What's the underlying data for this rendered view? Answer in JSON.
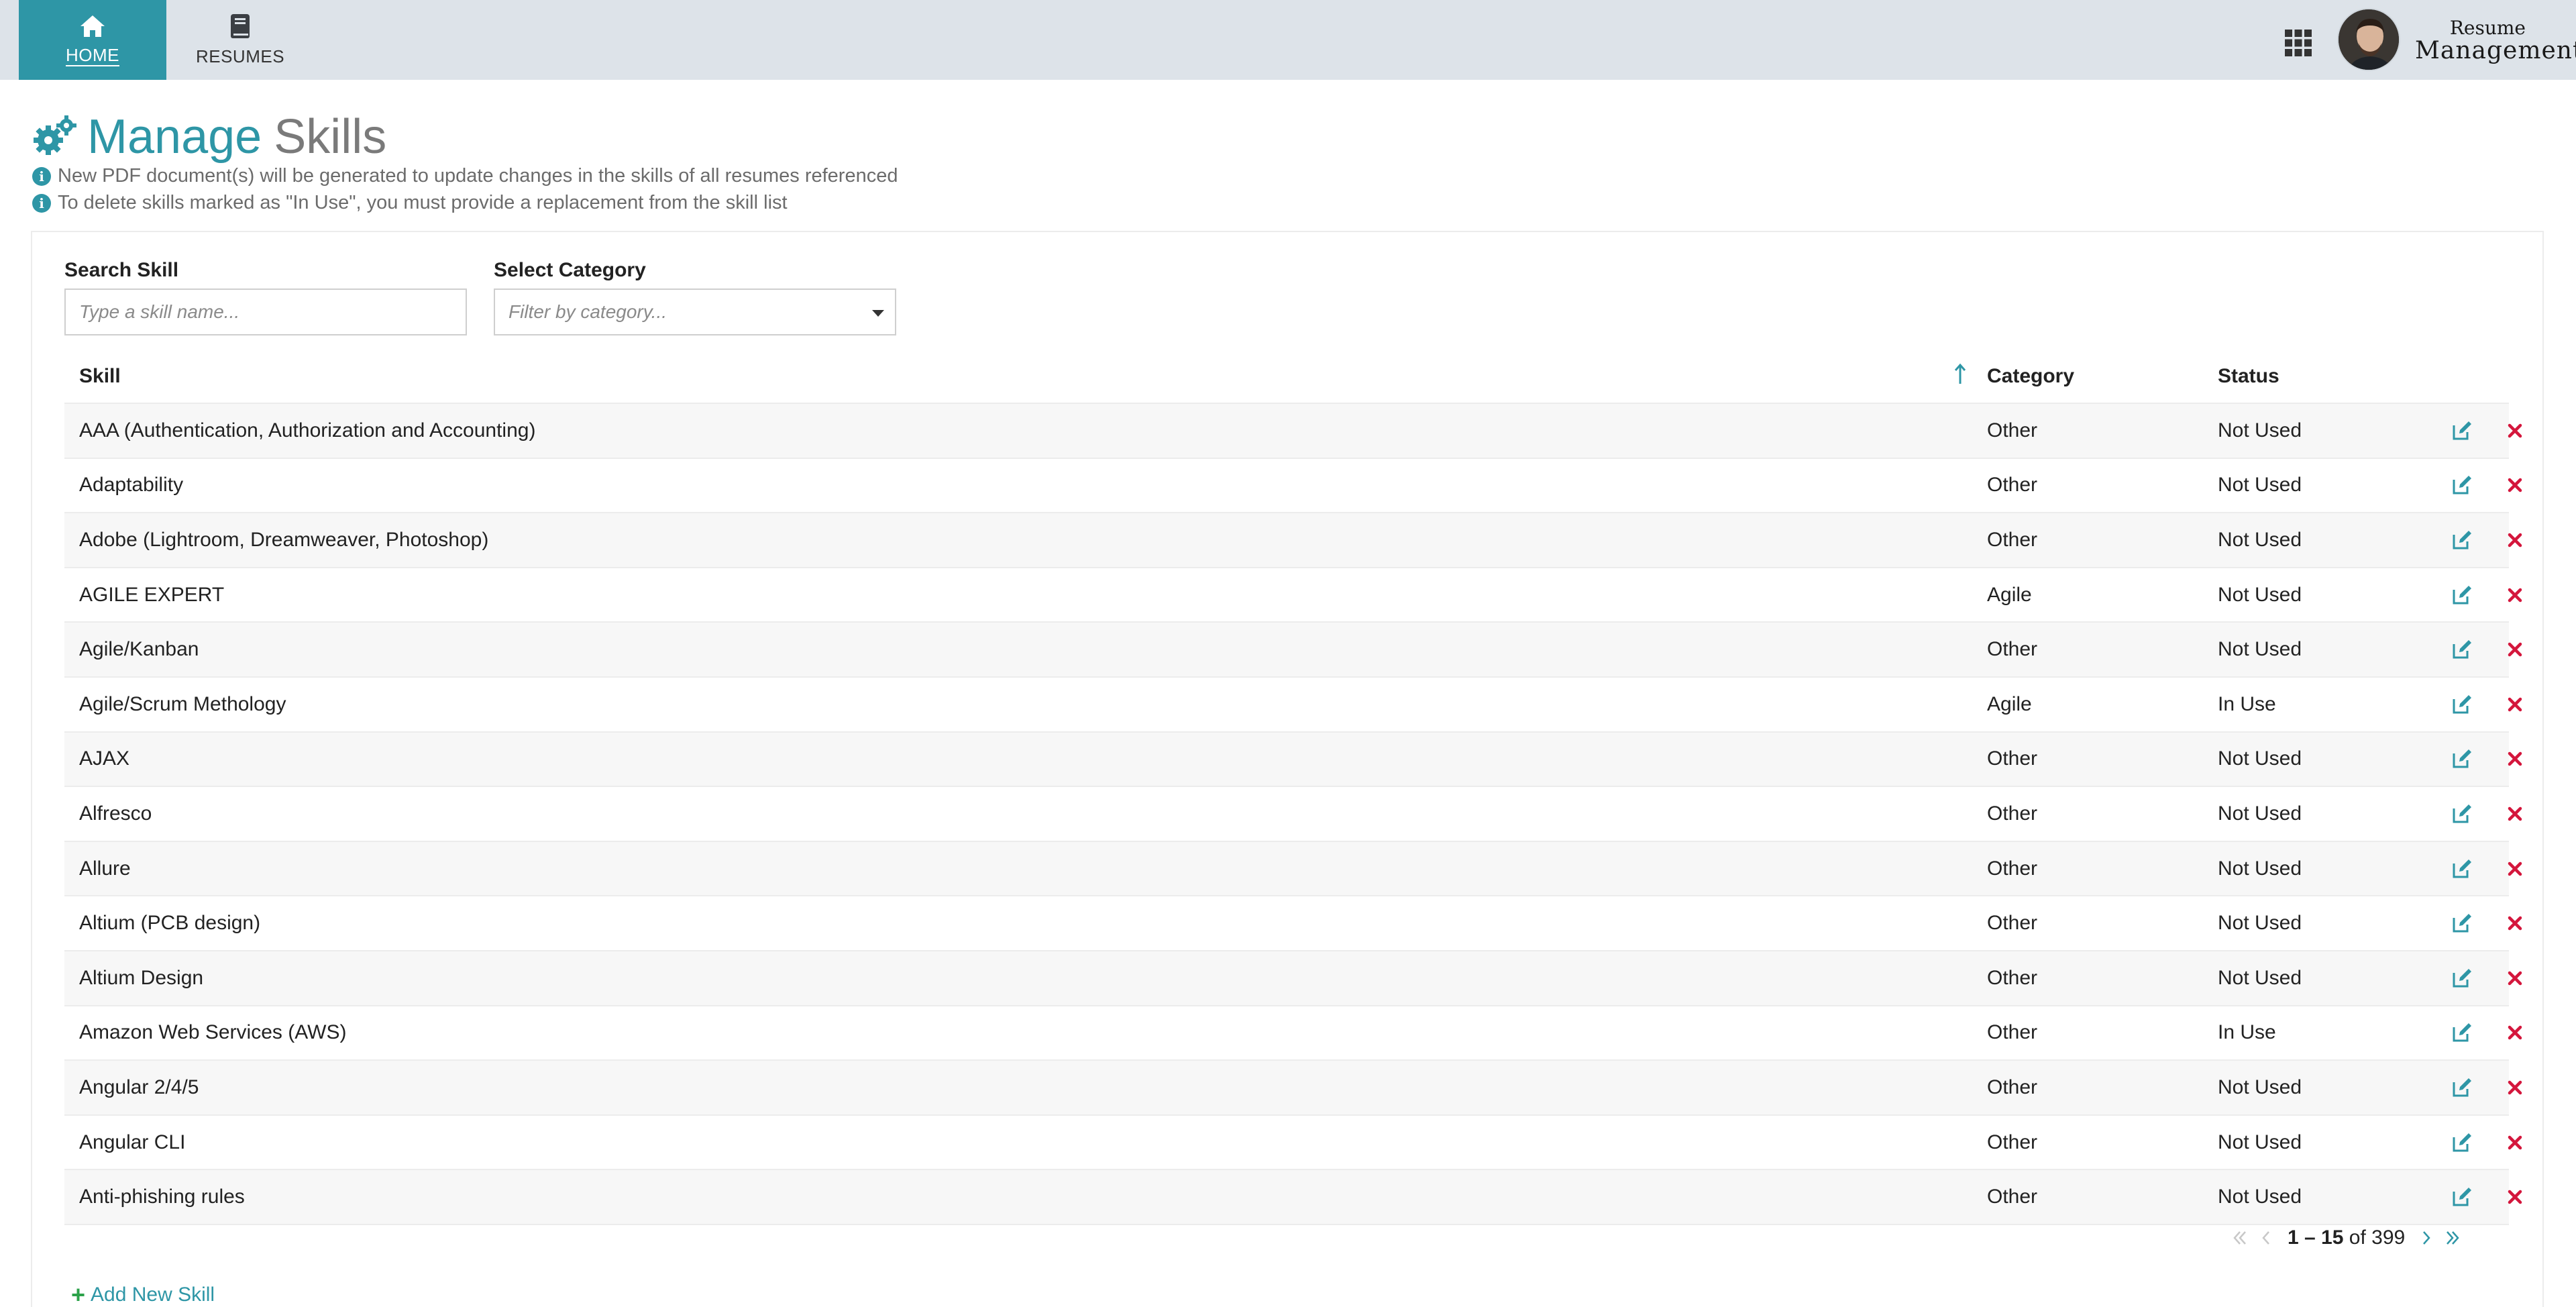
{
  "nav": {
    "home_label": "HOME",
    "resumes_label": "RESUMES"
  },
  "brand": {
    "top": "Resume",
    "bottom": "Management"
  },
  "page": {
    "title_part1": "Manage",
    "title_part2": "Skills",
    "info1": "New PDF document(s) will be generated to update changes in the skills of all resumes referenced",
    "info2": "To delete skills marked as \"In Use\", you must provide a replacement from the skill list"
  },
  "filters": {
    "search_label": "Search Skill",
    "search_placeholder": "Type a skill name...",
    "category_label": "Select Category",
    "category_placeholder": "Filter by category..."
  },
  "table": {
    "headers": {
      "skill": "Skill",
      "category": "Category",
      "status": "Status"
    },
    "rows": [
      {
        "skill": "AAA (Authentication, Authorization and Accounting)",
        "category": "Other",
        "status": "Not Used"
      },
      {
        "skill": "Adaptability",
        "category": "Other",
        "status": "Not Used"
      },
      {
        "skill": "Adobe (Lightroom, Dreamweaver, Photoshop)",
        "category": "Other",
        "status": "Not Used"
      },
      {
        "skill": "AGILE EXPERT",
        "category": "Agile",
        "status": "Not Used"
      },
      {
        "skill": "Agile/Kanban",
        "category": "Other",
        "status": "Not Used"
      },
      {
        "skill": "Agile/Scrum Methology",
        "category": "Agile",
        "status": "In Use"
      },
      {
        "skill": "AJAX",
        "category": "Other",
        "status": "Not Used"
      },
      {
        "skill": "Alfresco",
        "category": "Other",
        "status": "Not Used"
      },
      {
        "skill": "Allure",
        "category": "Other",
        "status": "Not Used"
      },
      {
        "skill": "Altium (PCB design)",
        "category": "Other",
        "status": "Not Used"
      },
      {
        "skill": "Altium Design",
        "category": "Other",
        "status": "Not Used"
      },
      {
        "skill": "Amazon Web Services (AWS)",
        "category": "Other",
        "status": "In Use"
      },
      {
        "skill": "Angular 2/4/5",
        "category": "Other",
        "status": "Not Used"
      },
      {
        "skill": "Angular CLI",
        "category": "Other",
        "status": "Not Used"
      },
      {
        "skill": "Anti-phishing rules",
        "category": "Other",
        "status": "Not Used"
      }
    ]
  },
  "pagination": {
    "range": "1 – 15",
    "of_label": "of",
    "total": "399"
  },
  "add_skill_label": "Add New Skill",
  "colors": {
    "accent": "#2e96a6",
    "nav_bg": "#dde3e9",
    "delete": "#d4163c",
    "add": "#2ca24a"
  }
}
